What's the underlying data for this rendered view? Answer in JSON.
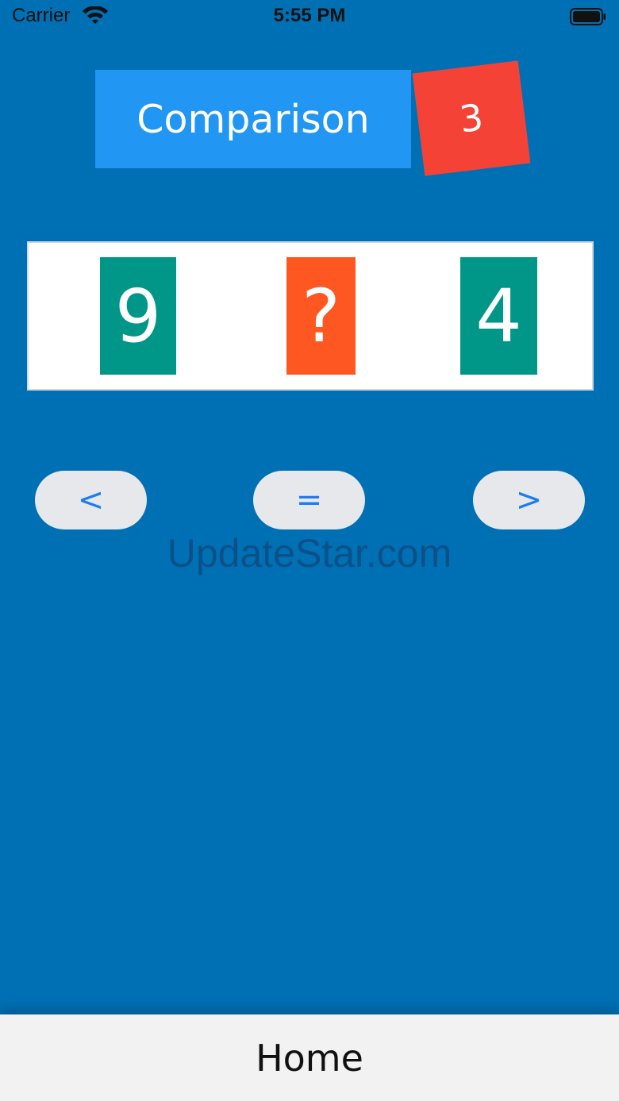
{
  "status_bar": {
    "carrier": "Carrier",
    "time": "5:55 PM",
    "wifi_icon": "wifi-icon",
    "battery_icon": "battery-icon"
  },
  "header": {
    "title": "Comparison",
    "score": "3"
  },
  "cards": {
    "left": "9",
    "middle": "?",
    "right": "4"
  },
  "buttons": {
    "less": "<",
    "equal": "=",
    "greater": ">"
  },
  "watermark": "UpdateStar.com",
  "bottom_bar": {
    "home_label": "Home"
  },
  "colors": {
    "background": "#0070B4",
    "title_box": "#2196F3",
    "score_badge": "#F44336",
    "number_card": "#009688",
    "unknown_card": "#FF5722",
    "button_text": "#1E7CF2",
    "button_bg": "#E6E8EB",
    "bottom_bar": "#F2F2F2"
  }
}
